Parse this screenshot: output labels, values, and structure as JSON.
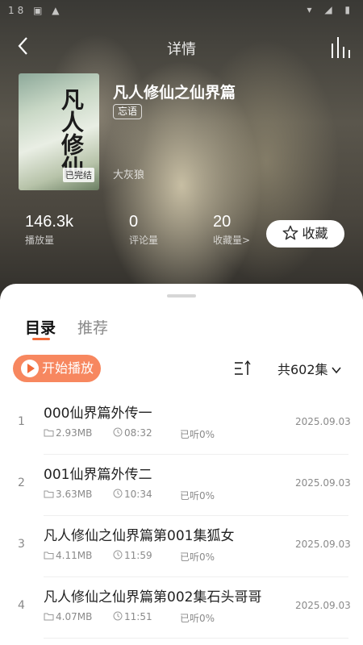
{
  "status_bar": {
    "left": "18 ▣ ▲",
    "right": "▾ ◢ ▮"
  },
  "nav": {
    "title": "详情"
  },
  "book": {
    "cover_text": "凡人修仙",
    "cover_badge": "已完结",
    "title": "凡人修仙之仙界篇",
    "tag": "忘语",
    "author": "大灰狼"
  },
  "stats": [
    {
      "value": "146.3k",
      "label": "播放量"
    },
    {
      "value": "0",
      "label": "评论量"
    },
    {
      "value": "20",
      "label": "收藏量>"
    }
  ],
  "collect_button": "收藏",
  "tabs": [
    {
      "label": "目录",
      "active": true
    },
    {
      "label": "推荐",
      "active": false
    }
  ],
  "play_button": "开始播放",
  "episode_count": "共602集",
  "episodes": [
    {
      "index": "1",
      "title": "000仙界篇外传一",
      "size": "2.93MB",
      "duration": "08:32",
      "progress": "已听0%",
      "date": "2025.09.03"
    },
    {
      "index": "2",
      "title": "001仙界篇外传二",
      "size": "3.63MB",
      "duration": "10:34",
      "progress": "已听0%",
      "date": "2025.09.03"
    },
    {
      "index": "3",
      "title": "凡人修仙之仙界篇第001集狐女",
      "size": "4.11MB",
      "duration": "11:59",
      "progress": "已听0%",
      "date": "2025.09.03"
    },
    {
      "index": "4",
      "title": "凡人修仙之仙界篇第002集石头哥哥",
      "size": "4.07MB",
      "duration": "11:51",
      "progress": "已听0%",
      "date": "2025.09.03"
    }
  ],
  "colors": {
    "accent": "#f26b3a",
    "play_button": "#f7875f"
  },
  "icons": [
    "back-arrow-icon",
    "equalizer-icon",
    "star-icon",
    "play-icon",
    "sort-icon",
    "chevron-down-icon",
    "folder-icon",
    "clock-icon",
    "headphone-icon"
  ]
}
